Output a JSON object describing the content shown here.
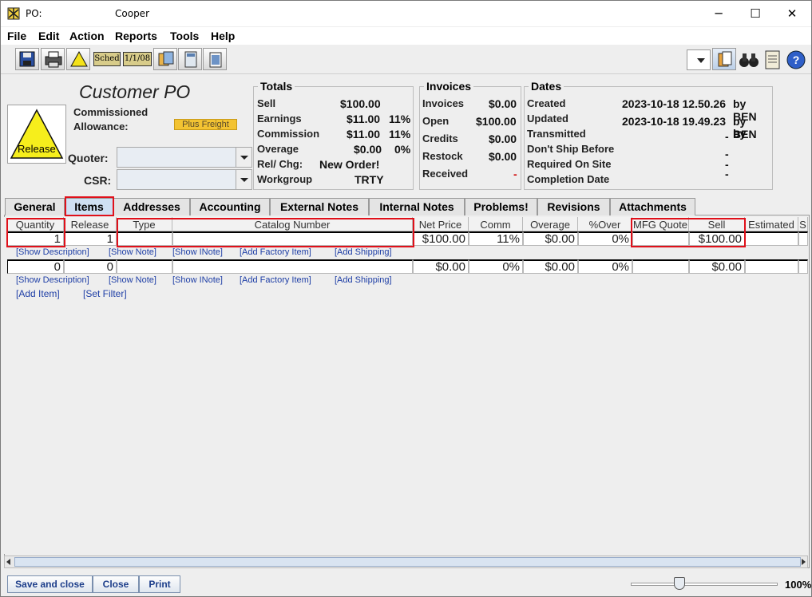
{
  "window": {
    "title_prefix": "PO:",
    "title_name": "Cooper",
    "minimize_glyph": "─",
    "maximize_glyph": "☐",
    "close_glyph": "✕"
  },
  "menu": [
    "File",
    "Edit",
    "Action",
    "Reports",
    "Tools",
    "Help"
  ],
  "toolbar": {
    "sched_label": "Sched",
    "date_label": "1/1/08"
  },
  "header": {
    "heading": "Customer PO",
    "commissioned": "Commissioned",
    "allowance": "Allowance:",
    "plus_freight": "Plus Freight",
    "release_label": "Release",
    "quoter_label": "Quoter:",
    "csr_label": "CSR:"
  },
  "totals": {
    "title": "Totals",
    "sell_label": "Sell",
    "sell_value": "$100.00",
    "earnings_label": "Earnings",
    "earnings_value": "$11.00",
    "earnings_pct": "11%",
    "commission_label": "Commission",
    "commission_value": "$11.00",
    "commission_pct": "11%",
    "overage_label": "Overage",
    "overage_value": "$0.00",
    "overage_pct": "0%",
    "relchg_label": "Rel/ Chg:",
    "relchg_value": "New Order!",
    "workgroup_label": "Workgroup",
    "workgroup_value": "TRTY"
  },
  "invoices": {
    "title": "Invoices",
    "invoices_label": "Invoices",
    "invoices_value": "$0.00",
    "open_label": "Open",
    "open_value": "$100.00",
    "credits_label": "Credits",
    "credits_value": "$0.00",
    "restock_label": "Restock",
    "restock_value": "$0.00",
    "received_label": "Received",
    "received_value": "-"
  },
  "dates": {
    "title": "Dates",
    "created_label": "Created",
    "created_value": "2023-10-18 12.50.26",
    "created_by": "by BEN",
    "updated_label": "Updated",
    "updated_value": "2023-10-18 19.49.23",
    "updated_by": "by BEN",
    "transmitted_label": "Transmitted",
    "transmitted_value": "-",
    "transmitted_by": "by",
    "dont_ship_label": "Don't Ship Before",
    "dont_ship_value": "-",
    "required_label": "Required On Site",
    "required_value": "-",
    "completion_label": "Completion Date",
    "completion_value": "-"
  },
  "tabs": [
    "General",
    "Items",
    "Addresses",
    "Accounting",
    "External Notes",
    "Internal Notes",
    "Problems!",
    "Revisions",
    "Attachments"
  ],
  "grid": {
    "columns": [
      "Quantity",
      "Release",
      "Type",
      "Catalog Number",
      "Net Price",
      "Comm",
      "Overage",
      "%Over",
      "MFG Quote",
      "Sell",
      "Estimated",
      "S"
    ],
    "rows": [
      {
        "quantity": "1",
        "release": "1",
        "type": "",
        "catalog": "",
        "net_price": "$100.00",
        "comm": "11%",
        "overage": "$0.00",
        "pct_over": "0%",
        "mfg_quote": "",
        "sell": "$100.00",
        "estimated": ""
      },
      {
        "quantity": "0",
        "release": "0",
        "type": "",
        "catalog": "",
        "net_price": "$0.00",
        "comm": "0%",
        "overage": "$0.00",
        "pct_over": "0%",
        "mfg_quote": "",
        "sell": "$0.00",
        "estimated": ""
      }
    ],
    "row_links": [
      "[Show Description]",
      "[Show Note]",
      "[Show INote]",
      "[Add Factory Item]",
      "[Add Shipping]"
    ],
    "add_item": "[Add Item]",
    "set_filter": "[Set Filter]"
  },
  "footer": {
    "save_close": "Save and close",
    "close": "Close",
    "print": "Print",
    "zoom": "100%"
  }
}
